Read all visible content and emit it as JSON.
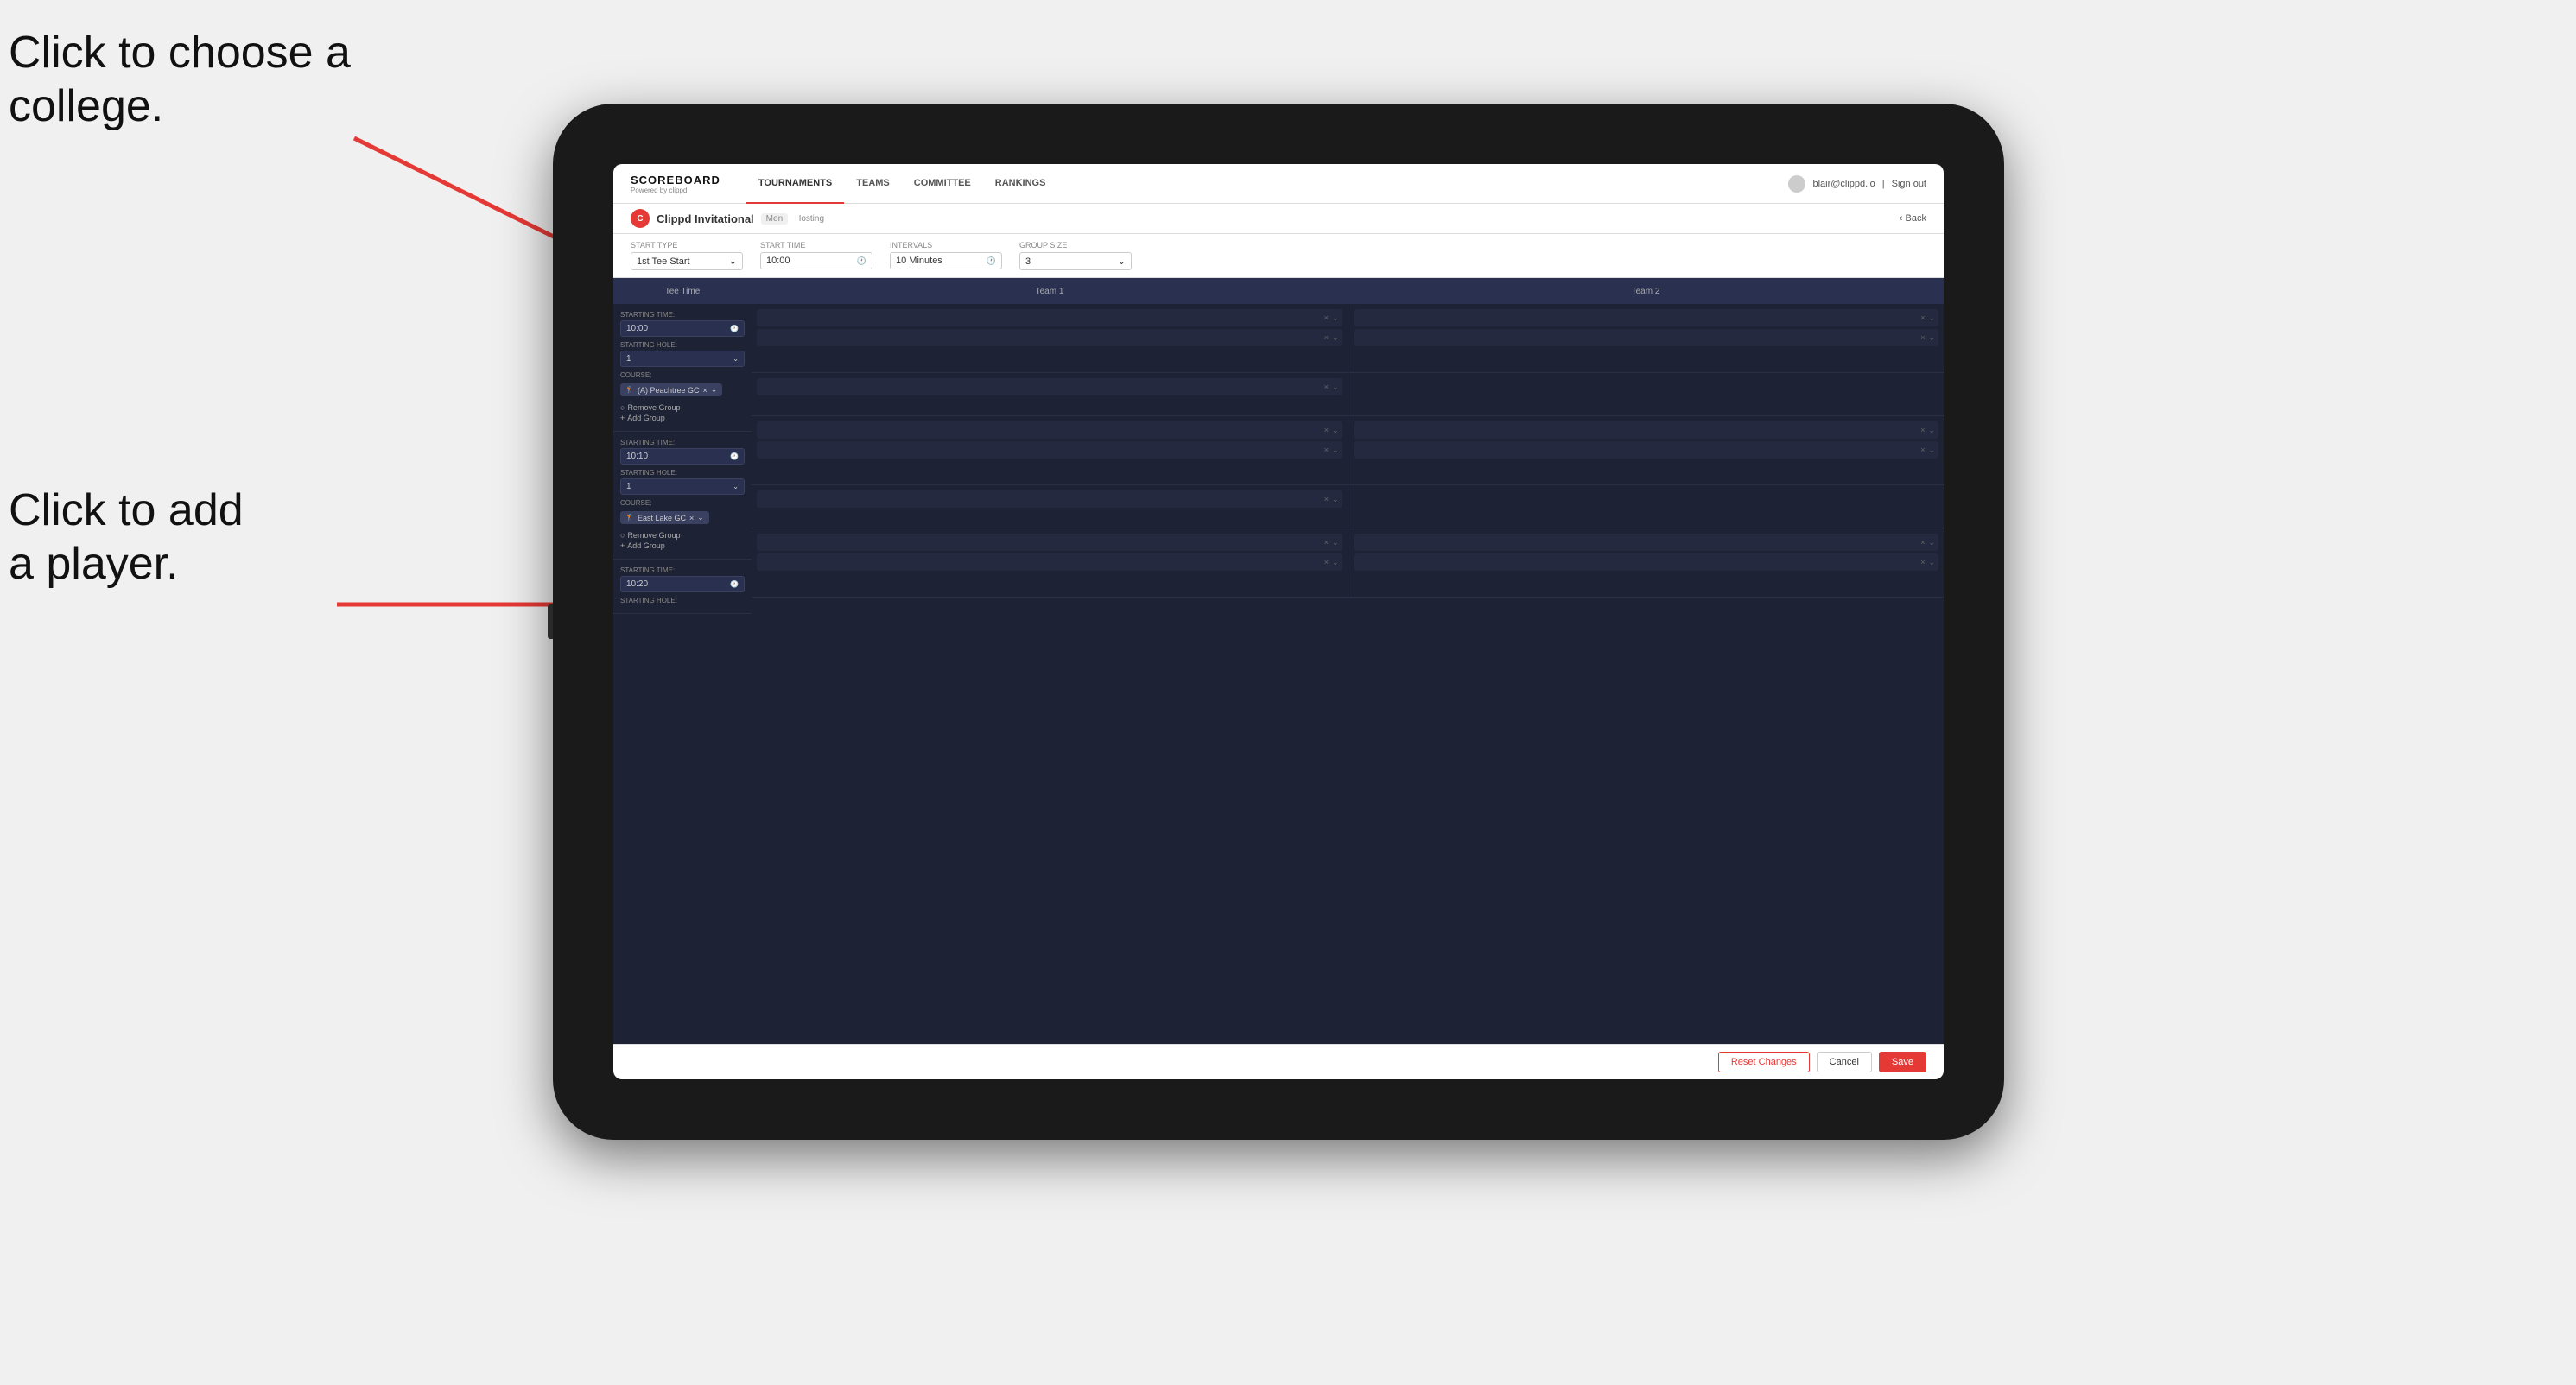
{
  "annotations": {
    "text1": "Click to choose a\ncollege.",
    "text2": "Click to add\na player."
  },
  "nav": {
    "logo_title": "SCOREBOARD",
    "logo_sub": "Powered by clippd",
    "links": [
      "TOURNAMENTS",
      "TEAMS",
      "COMMITTEE",
      "RANKINGS"
    ],
    "active_link": "TOURNAMENTS",
    "user_email": "blair@clippd.io",
    "sign_out": "Sign out"
  },
  "sub_header": {
    "title": "Clippd Invitational",
    "badge": "Men",
    "tag": "Hosting",
    "back": "Back"
  },
  "controls": {
    "start_type_label": "Start Type",
    "start_type_value": "1st Tee Start",
    "start_time_label": "Start Time",
    "start_time_value": "10:00",
    "intervals_label": "Intervals",
    "intervals_value": "10 Minutes",
    "group_size_label": "Group Size",
    "group_size_value": "3"
  },
  "table": {
    "col1": "Tee Time",
    "col2": "Team 1",
    "col3": "Team 2"
  },
  "groups": [
    {
      "starting_time": "10:00",
      "starting_hole": "1",
      "course": "(A) Peachtree GC",
      "team1_slots": 2,
      "team2_slots": 2
    },
    {
      "starting_time": "10:10",
      "starting_hole": "1",
      "course": "East Lake GC",
      "team1_slots": 2,
      "team2_slots": 2
    },
    {
      "starting_time": "10:20",
      "starting_hole": "",
      "course": "",
      "team1_slots": 2,
      "team2_slots": 2
    }
  ],
  "footer": {
    "reset_label": "Reset Changes",
    "cancel_label": "Cancel",
    "save_label": "Save"
  }
}
